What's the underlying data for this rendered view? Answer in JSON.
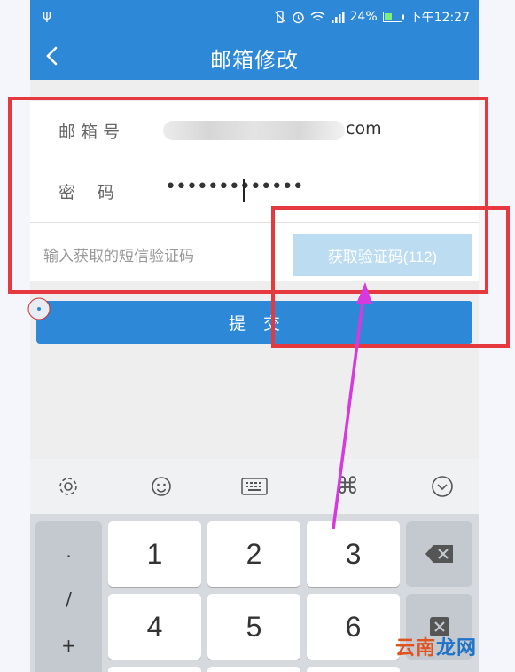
{
  "status_bar": {
    "battery": "24%",
    "time": "下午12:27"
  },
  "header": {
    "title": "邮箱修改",
    "back_icon": "chevron-left-icon"
  },
  "form": {
    "email_label": "邮 箱 号",
    "email_value_visible": "com",
    "password_label": "密　 码",
    "password_value": "•••••••••••••",
    "sms_code_placeholder": "输入获取的短信验证码",
    "get_code_button": "获取验证码(112)"
  },
  "submit_button": "提交",
  "keyboard": {
    "toolbar_icons": [
      "gear-icon",
      "emoji-icon",
      "keyboard-icon",
      "command-icon",
      "collapse-icon"
    ],
    "symbols": [
      ".",
      "/",
      "+"
    ],
    "numbers": [
      "1",
      "2",
      "3",
      "4",
      "5",
      "6"
    ]
  },
  "watermark": {
    "part1": "云南",
    "part2": "龙网"
  },
  "colors": {
    "accent": "#2d88d8",
    "annotation": "#e5393f",
    "arrow": "#d63adf"
  }
}
